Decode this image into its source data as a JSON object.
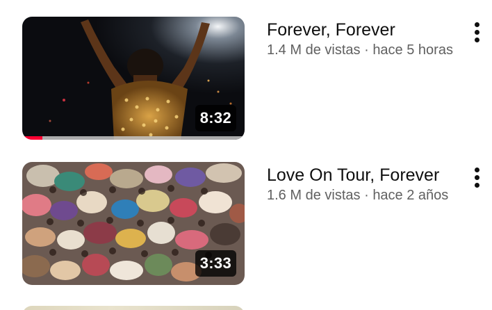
{
  "videos": [
    {
      "title": "Forever, Forever",
      "views": "1.4 M de vistas",
      "separator": "·",
      "age": "hace 5 horas",
      "duration": "8:32",
      "watched_fraction": 0.09,
      "thumbnail_icon": "concert-performer-thumbnail"
    },
    {
      "title": "Love On Tour, Forever",
      "views": "1.6 M de vistas",
      "separator": "·",
      "age": "hace 2 años",
      "duration": "3:33",
      "watched_fraction": 0,
      "thumbnail_icon": "crowd-aerial-thumbnail"
    }
  ],
  "more_icon": "more-vertical-icon",
  "colors": {
    "progress": "#ff0033",
    "title_text": "#0f0f0f",
    "meta_text": "#606060"
  }
}
